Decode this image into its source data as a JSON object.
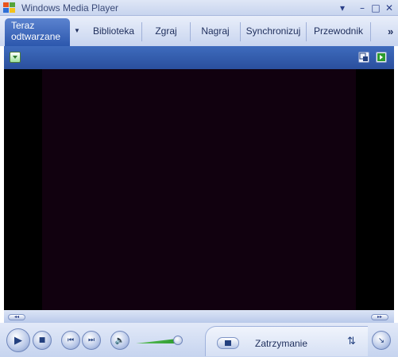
{
  "window": {
    "title": "Windows Media Player"
  },
  "tabs": [
    {
      "label": "Teraz",
      "label2": "odtwarzane",
      "active": true
    },
    {
      "label": "Biblioteka"
    },
    {
      "label": "Zgraj"
    },
    {
      "label": "Nagraj"
    },
    {
      "label": "Synchronizuj"
    },
    {
      "label": "Przewodnik"
    }
  ],
  "tabs_more": "»",
  "icons": {
    "menu": "chevron-down-icon",
    "minimize": "minimize-icon",
    "maximize": "maximize-icon",
    "close": "close-icon",
    "playlist": "playlist-options-icon",
    "compact": "compact-mode-icon",
    "fullscreen": "fullscreen-icon"
  },
  "playback": {
    "status": "Zatrzymanie",
    "volume": 0.95
  },
  "colors": {
    "accent": "#2c57ad",
    "video_bg": "#000000",
    "video_content": "#11010f",
    "volume": "#3fae3f"
  }
}
